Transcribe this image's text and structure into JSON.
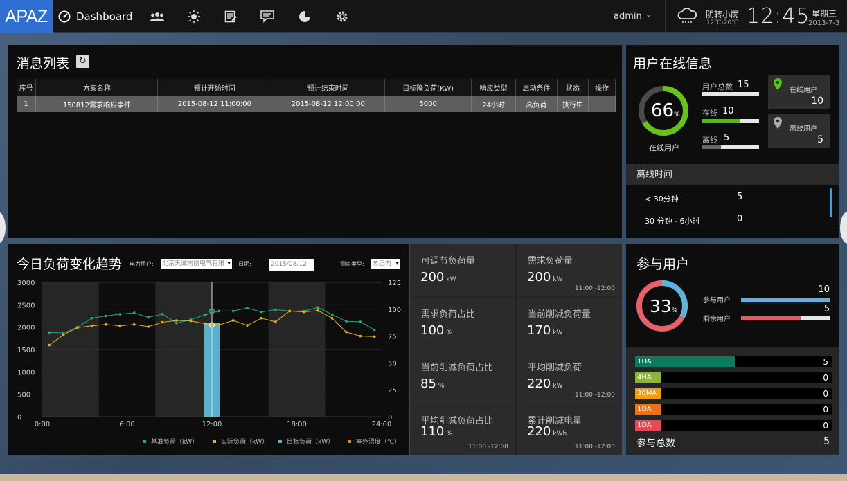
{
  "topbar": {
    "logo": "APAZ",
    "nav_dashboard": "Dashboard",
    "nav_icons": [
      "users-icon",
      "sun-icon",
      "report-icon",
      "message-icon",
      "pie-icon",
      "gear-icon"
    ],
    "user": "admin",
    "weather": "阴转小雨",
    "temp_range": "12℃-20℃",
    "time": "12:45",
    "weekday": "星期三",
    "date": "2013-7-3"
  },
  "messages": {
    "title": "消息列表",
    "columns": [
      "序号",
      "方案名称",
      "预计开始时间",
      "预计结束时间",
      "目标降负荷(KW)",
      "响应类型",
      "启动条件",
      "状态",
      "操作"
    ],
    "rows": [
      [
        "1",
        "150812需求响应事件",
        "2015-08-12 11:00:00",
        "2015-08-12 12:00:00",
        "5000",
        "24小时",
        "高负荷",
        "执行中",
        ""
      ]
    ]
  },
  "online": {
    "title": "用户在线信息",
    "percent": "66",
    "percent_unit": "%",
    "percent_value": 66,
    "center_label": "在线用户",
    "total_label": "用户总数",
    "total": "15",
    "online_label": "在线",
    "online": "10",
    "offline_label": "离线",
    "offline": "5",
    "card_online_label": "在线用户",
    "card_online": "10",
    "card_offline_label": "离线用户",
    "card_offline": "5",
    "offline_time_title": "离线时间",
    "offline_rows": [
      {
        "label": "< 30分钟",
        "value": "5"
      },
      {
        "label": "30 分钟 - 6小时",
        "value": "0"
      }
    ]
  },
  "trend": {
    "title": "今日负荷变化趋势",
    "user_label": "电力用户:",
    "user_value": "北京天诚同创电气有限",
    "date_label": "日期:",
    "date_value": "2015/08/12",
    "type_label": "测点类型:",
    "type_value": "总正向"
  },
  "chart_data": {
    "type": "line",
    "x": [
      "0:00",
      "1:00",
      "2:00",
      "3:00",
      "4:00",
      "5:00",
      "6:00",
      "7:00",
      "8:00",
      "9:00",
      "10:00",
      "11:00",
      "12:00",
      "13:00",
      "14:00",
      "15:00",
      "16:00",
      "17:00",
      "18:00",
      "19:00",
      "20:00",
      "21:00",
      "22:00",
      "23:00"
    ],
    "xticks": [
      "0:00",
      "6:00",
      "12:00",
      "18:00",
      "24:00"
    ],
    "yticks_left": [
      "3000",
      "2500",
      "2000",
      "1500",
      "1000",
      "500",
      "0"
    ],
    "yticks_right": [
      "125",
      "100",
      "75",
      "50",
      "25",
      "0"
    ],
    "ylim_left": [
      0,
      3000
    ],
    "ylim_right": [
      0,
      125
    ],
    "series": [
      {
        "name": "基准负荷（kW）",
        "color": "#1fae7c",
        "values": [
          1880,
          1870,
          2000,
          2200,
          2250,
          2290,
          2320,
          2220,
          2290,
          2090,
          2170,
          2270,
          2360,
          2360,
          2430,
          2340,
          2390,
          2360,
          2360,
          2440,
          2280,
          2130,
          2120,
          1940
        ]
      },
      {
        "name": "实际负荷（kW）",
        "color": "#e8b21a",
        "values": [
          1600,
          1830,
          1990,
          2030,
          2060,
          2030,
          2060,
          2010,
          2110,
          2150,
          2140,
          2080,
          2050,
          2150,
          2040,
          2200,
          2120,
          2360,
          2340,
          2370,
          2200,
          1890,
          1800,
          1790
        ]
      },
      {
        "name": "目标负荷（kW）",
        "color": "#58b2cf",
        "bar_hour": 12,
        "value": 2100
      },
      {
        "name": "室外温度（℃）",
        "color": "#e0851d",
        "values": []
      }
    ]
  },
  "stats": [
    {
      "label": "可调节负荷量",
      "value": "200",
      "unit": "kW",
      "time": ""
    },
    {
      "label": "需求负荷量",
      "value": "200",
      "unit": "kW",
      "time": "11:00 -12:00"
    },
    {
      "label": "需求负荷占比",
      "value": "100",
      "unit": "%",
      "time": ""
    },
    {
      "label": "当前削减负荷量",
      "value": "170",
      "unit": "kW",
      "time": ""
    },
    {
      "label": "当前削减负荷占比",
      "value": "85",
      "unit": "%",
      "time": ""
    },
    {
      "label": "平均削减负荷",
      "value": "220",
      "unit": "kW",
      "time": "11:00 -12:00"
    },
    {
      "label": "平均削减负荷占比",
      "value": "110",
      "unit": "%",
      "time": "11:00 -12:00"
    },
    {
      "label": "累计削减电量",
      "value": "220",
      "unit": "kWh",
      "time": "11:00 -12:00"
    }
  ],
  "participate": {
    "title": "参与用户",
    "percent": "33",
    "percent_unit": "%",
    "percent_value": 33,
    "joined_label": "参与用户",
    "joined": "10",
    "remaining_label": "剩余用户",
    "remaining": "5",
    "bars": [
      {
        "tag": "1DA",
        "color": "#0e7a5d",
        "tagcolor": "#0e7a5d",
        "value": "5",
        "fraction": 0.43
      },
      {
        "tag": "4HA",
        "color": "#8cb43c",
        "tagcolor": "#8cb43c",
        "value": "0",
        "fraction": 0
      },
      {
        "tag": "30MA",
        "color": "#f39c12",
        "tagcolor": "#f39c12",
        "value": "0",
        "fraction": 0
      },
      {
        "tag": "1DA",
        "color": "#e8731a",
        "tagcolor": "#e8731a",
        "value": "0",
        "fraction": 0
      },
      {
        "tag": "1DA",
        "color": "#e8484f",
        "tagcolor": "#e8484f",
        "value": "0",
        "fraction": 0
      }
    ],
    "total_label": "参与总数",
    "total": "5"
  }
}
